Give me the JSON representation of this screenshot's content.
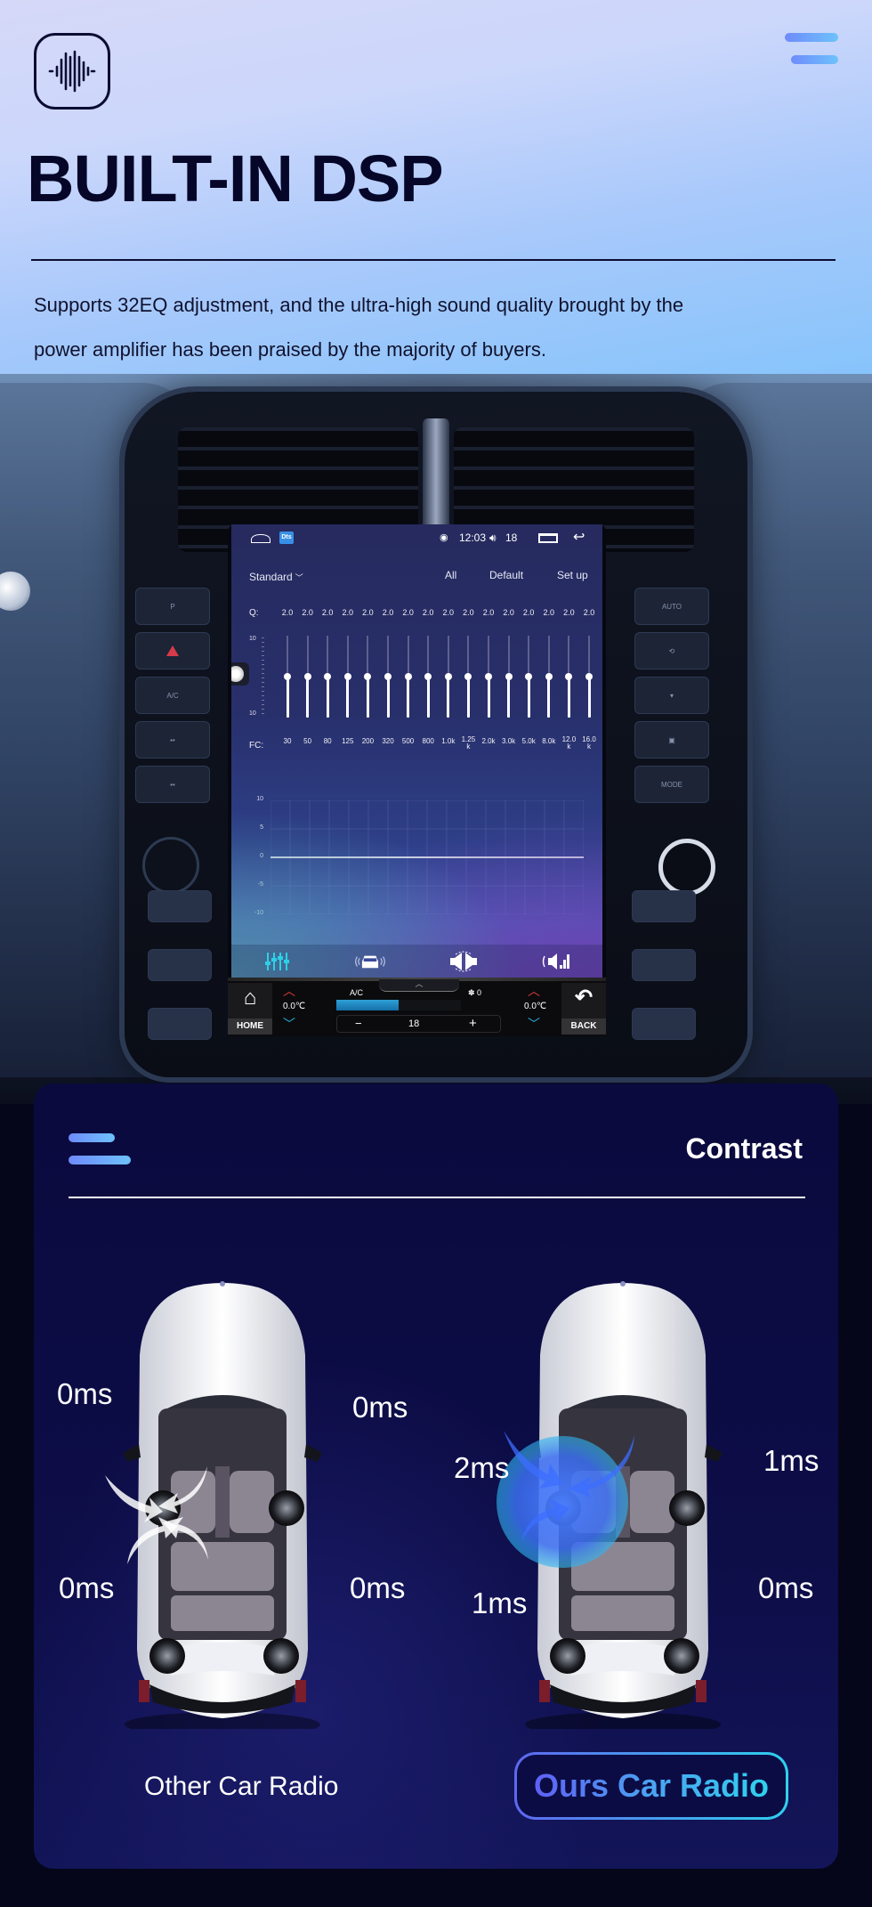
{
  "header": {
    "logo_icon": "sound-wave-icon",
    "menu_icon": "hamburger-menu-icon",
    "title": "BUILT-IN DSP",
    "description_line1": "Supports 32EQ adjustment, and the ultra-high sound quality brought by the",
    "description_line2": "power amplifier has been praised by the majority of buyers."
  },
  "head_unit": {
    "status_bar": {
      "home_icon": "home-outline-icon",
      "app_icon_label": "Dts",
      "wifi_icon": "hotspot-icon",
      "time": "12:03",
      "volume_icon": "speaker-icon",
      "volume": "18",
      "recent_apps_icon": "recent-apps-icon",
      "back_icon": "back-arrow-icon"
    },
    "eq": {
      "preset": "Standard",
      "tabs": [
        "All",
        "Default",
        "Set up"
      ],
      "q_label": "Q:",
      "q_values": [
        "2.0",
        "2.0",
        "2.0",
        "2.0",
        "2.0",
        "2.0",
        "2.0",
        "2.0",
        "2.0",
        "2.0",
        "2.0",
        "2.0",
        "2.0",
        "2.0",
        "2.0",
        "2.0"
      ],
      "scale_max_label": "10",
      "scale_min_label": "10",
      "scale_range": [
        -10,
        10
      ],
      "band_gains": [
        0,
        0,
        0,
        0,
        0,
        0,
        0,
        0,
        0,
        0,
        0,
        0,
        0,
        0,
        0,
        0
      ],
      "fc_label": "FC:",
      "fc_values": [
        "30",
        "50",
        "80",
        "125",
        "200",
        "320",
        "500",
        "800",
        "1.0k",
        "1.25 k",
        "2.0k",
        "3.0k",
        "5.0k",
        "8.0k",
        "12.0 k",
        "16.0 k"
      ],
      "curve_ticks": [
        "10",
        "5",
        "0",
        "-5",
        "-10"
      ]
    },
    "mode_tabs": [
      {
        "icon": "equalizer-icon",
        "active": true
      },
      {
        "icon": "car-surround-icon",
        "active": false
      },
      {
        "icon": "speaker-balance-icon",
        "active": false
      },
      {
        "icon": "subwoofer-icon",
        "active": false
      }
    ],
    "climate": {
      "home_label": "HOME",
      "back_label": "BACK",
      "left_temp": "0.0℃",
      "right_temp": "0.0℃",
      "ac_label": "A/C",
      "fan_label": "0",
      "fan_level_fraction": 0.5,
      "stepper_minus": "−",
      "stepper_value": "18",
      "stepper_plus": "+"
    },
    "dash_buttons_left": [
      "P",
      "hazard",
      "A/C",
      "",
      ""
    ],
    "dash_buttons_right": [
      "AUTO",
      "",
      "",
      "",
      "MODE"
    ]
  },
  "contrast": {
    "menu_icon": "hamburger-menu-icon",
    "title": "Contrast",
    "other": {
      "label": "Other Car Radio",
      "delays": {
        "front_left": "0ms",
        "front_right": "0ms",
        "rear_left": "0ms",
        "rear_right": "0ms"
      }
    },
    "ours": {
      "label": "Ours Car Radio",
      "delays": {
        "front_left": "2ms",
        "front_right": "1ms",
        "rear_left": "1ms",
        "rear_right": "0ms"
      }
    }
  },
  "colors": {
    "title_ink": "#050628",
    "accent_blue": "#5f67f0",
    "accent_cyan": "#2fd1ee",
    "card_bg": "#0b0a3e"
  }
}
